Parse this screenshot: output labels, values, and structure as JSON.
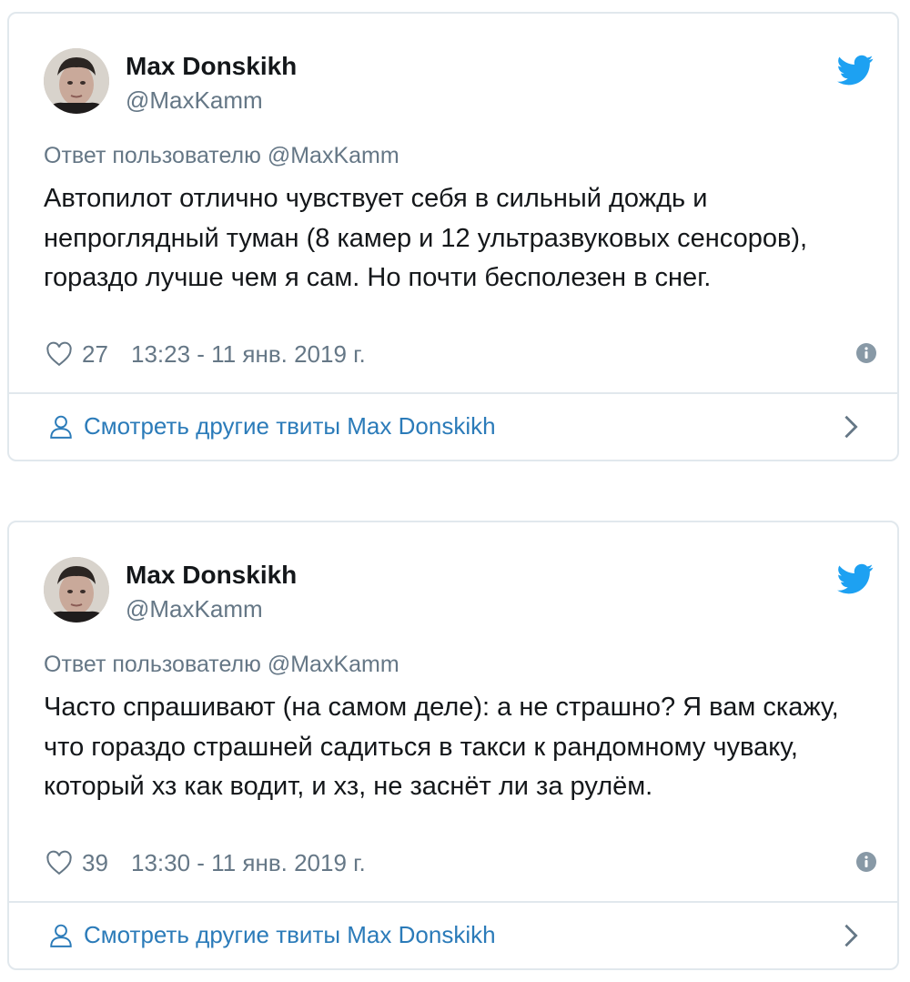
{
  "tweets": [
    {
      "author_name": "Max Donskikh",
      "handle": "@MaxKamm",
      "reply_to": "Ответ пользователю @MaxKamm",
      "text": "Автопилот отлично чувствует себя в сильный дождь и непроглядный туман (8 камер и 12 ультразвуковых сенсоров), гораздо лучше чем я сам. Но почти бесполезен в снег.",
      "likes": "27",
      "timestamp": "13:23 - 11 янв. 2019 г.",
      "more_label": "Смотреть другие твиты Max Donskikh"
    },
    {
      "author_name": "Max Donskikh",
      "handle": "@MaxKamm",
      "reply_to": "Ответ пользователю @MaxKamm",
      "text": "Часто спрашивают (на самом деле): а не страшно? Я вам скажу, что гораздо страшней садиться в такси к рандомному чуваку, который хз как водит, и хз, не заснёт ли за рулём.",
      "likes": "39",
      "timestamp": "13:30 - 11 янв. 2019 г.",
      "more_label": "Смотреть другие твиты Max Donskikh"
    }
  ],
  "icons": {
    "brand": "twitter-bird-icon",
    "like": "heart-icon",
    "info": "info-icon",
    "profile": "person-icon",
    "more": "chevron-right-icon"
  },
  "colors": {
    "twitter_blue": "#1da1f2",
    "link_blue": "#2b7bb9",
    "text": "#14171a",
    "secondary": "#657786",
    "border": "#e1e8ed"
  }
}
